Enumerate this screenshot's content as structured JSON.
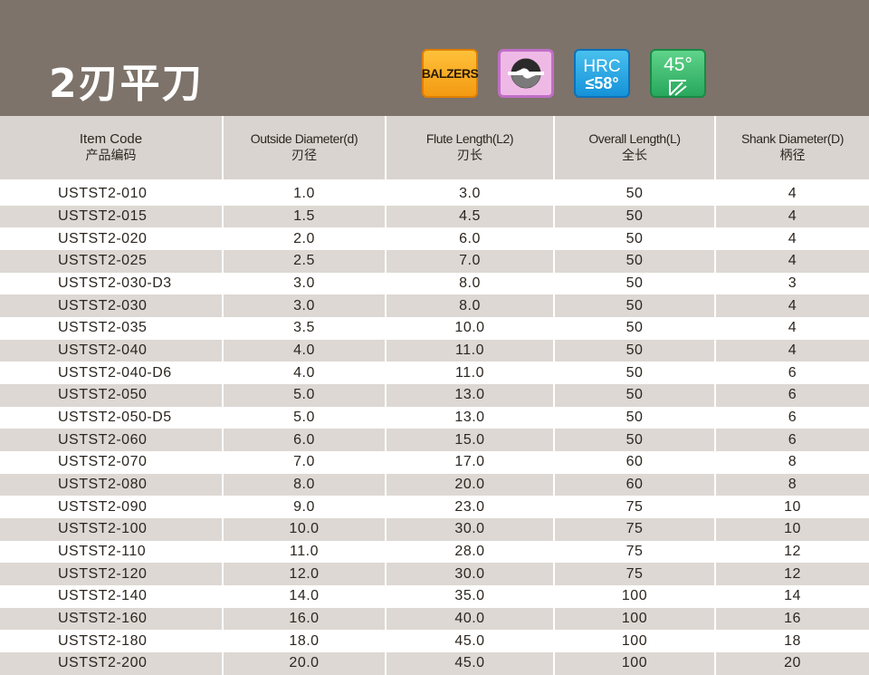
{
  "title": "2刃平刀",
  "badges": {
    "balzers": "BALZERS",
    "hrc_top": "HRC",
    "hrc_bottom": "≤58°",
    "angle": "45°"
  },
  "columns": [
    {
      "en": "Item Code",
      "zh": "产品编码"
    },
    {
      "en": "Outside Diameter(d)",
      "zh": "刃径"
    },
    {
      "en": "Flute Length(L2)",
      "zh": "刃长"
    },
    {
      "en": "Overall Length(L)",
      "zh": "全长"
    },
    {
      "en": "Shank Diameter(D)",
      "zh": "柄径"
    }
  ],
  "rows": [
    [
      "USTST2-010",
      "1.0",
      "3.0",
      "50",
      "4"
    ],
    [
      "USTST2-015",
      "1.5",
      "4.5",
      "50",
      "4"
    ],
    [
      "USTST2-020",
      "2.0",
      "6.0",
      "50",
      "4"
    ],
    [
      "USTST2-025",
      "2.5",
      "7.0",
      "50",
      "4"
    ],
    [
      "USTST2-030-D3",
      "3.0",
      "8.0",
      "50",
      "3"
    ],
    [
      "USTST2-030",
      "3.0",
      "8.0",
      "50",
      "4"
    ],
    [
      "USTST2-035",
      "3.5",
      "10.0",
      "50",
      "4"
    ],
    [
      "USTST2-040",
      "4.0",
      "11.0",
      "50",
      "4"
    ],
    [
      "USTST2-040-D6",
      "4.0",
      "11.0",
      "50",
      "6"
    ],
    [
      "USTST2-050",
      "5.0",
      "13.0",
      "50",
      "6"
    ],
    [
      "USTST2-050-D5",
      "5.0",
      "13.0",
      "50",
      "6"
    ],
    [
      "USTST2-060",
      "6.0",
      "15.0",
      "50",
      "6"
    ],
    [
      "USTST2-070",
      "7.0",
      "17.0",
      "60",
      "8"
    ],
    [
      "USTST2-080",
      "8.0",
      "20.0",
      "60",
      "8"
    ],
    [
      "USTST2-090",
      "9.0",
      "23.0",
      "75",
      "10"
    ],
    [
      "USTST2-100",
      "10.0",
      "30.0",
      "75",
      "10"
    ],
    [
      "USTST2-110",
      "11.0",
      "28.0",
      "75",
      "12"
    ],
    [
      "USTST2-120",
      "12.0",
      "30.0",
      "75",
      "12"
    ],
    [
      "USTST2-140",
      "14.0",
      "35.0",
      "100",
      "14"
    ],
    [
      "USTST2-160",
      "16.0",
      "40.0",
      "100",
      "16"
    ],
    [
      "USTST2-180",
      "18.0",
      "45.0",
      "100",
      "18"
    ],
    [
      "USTST2-200",
      "20.0",
      "45.0",
      "100",
      "20"
    ]
  ]
}
